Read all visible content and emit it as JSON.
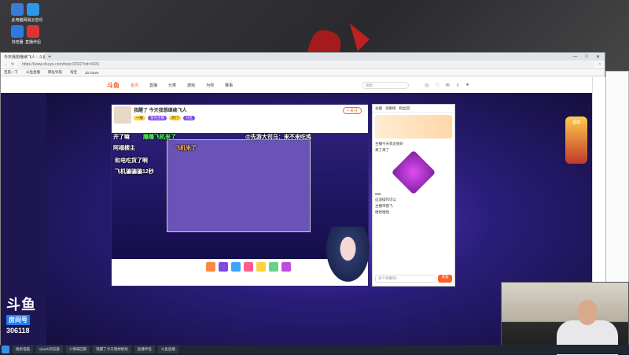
{
  "desktop": {
    "icons": [
      {
        "label": "此电脑",
        "color": "#3a7bd5"
      },
      {
        "label": "网易云音乐",
        "color": "#2a9ae8"
      },
      {
        "label": "浏览器",
        "color": "#2c7be5"
      },
      {
        "label": "直播伴侣",
        "color": "#d33"
      }
    ]
  },
  "browser": {
    "tab_title": "今天我想继续飞人 - 斗鱼",
    "new_tab": "+",
    "controls": [
      "—",
      "□",
      "✕"
    ],
    "url": "https://www.douyu.com/topic/2022?rid=3431",
    "bookmarks": [
      "百度一下",
      "斗鱼直播",
      "网址导航",
      "淘宝",
      "JD.Store"
    ]
  },
  "site": {
    "logo": "斗鱼",
    "nav": [
      "首页",
      "直播",
      "分类",
      "游戏",
      "为你",
      "赛事"
    ],
    "search_placeholder": "搜索",
    "nav_icons": [
      "history-icon",
      "follow-icon",
      "message-icon",
      "download-icon",
      "user-icon"
    ],
    "streamer": {
      "title": "我醒了 今天我想继续飞人",
      "follow_label": "+ 关注",
      "tags": [
        "一级",
        "星光主播",
        "热门",
        "分区"
      ]
    },
    "danmu": [
      {
        "text": "开了嘛",
        "cls": ""
      },
      {
        "text": "雕雕飞机来了",
        "cls": "g"
      },
      {
        "text": "@先游大司马：来不来吃鸡",
        "cls": ""
      },
      {
        "text": "阿福楼主",
        "cls": ""
      },
      {
        "text": "飞机来了",
        "cls": "o"
      },
      {
        "text": "和电吃货了啊",
        "cls": ""
      },
      {
        "text": "飞机骗骗骗12秒",
        "cls": ""
      }
    ],
    "chat": {
      "tabs": [
        "主播",
        "贡献榜",
        "粉丝团"
      ],
      "lines": [
        "主播今天状态很好",
        "来了来了",
        "666",
        "这波操作可以",
        "主播带我飞",
        "哈哈哈哈"
      ],
      "input_placeholder": "发个弹幕吧~",
      "send_label": "发送"
    },
    "promo_label": "福袋"
  },
  "overlay": {
    "logo_text": "斗鱼",
    "room_label": "房间号",
    "room_number": "306118"
  },
  "taskbar": {
    "items": [
      "搜索电脑",
      "Quark浏览器",
      "人情味回家",
      "我醒了今天我想继续",
      "直播伴侣",
      "斗鱼直播"
    ]
  }
}
